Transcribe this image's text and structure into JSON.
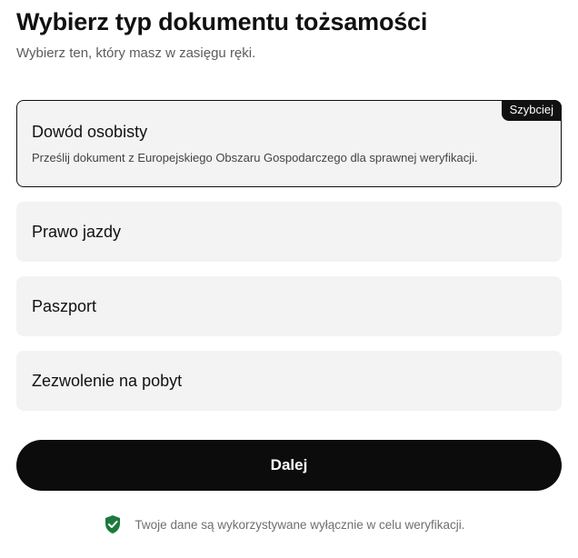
{
  "header": {
    "title": "Wybierz typ dokumentu tożsamości",
    "subtitle": "Wybierz ten, który masz w zasięgu ręki."
  },
  "options": [
    {
      "label": "Dowód osobisty",
      "description": "Prześlij dokument z Europejskiego Obszaru Gospodarczego dla sprawnej weryfikacji.",
      "badge": "Szybciej",
      "selected": true
    },
    {
      "label": "Prawo jazdy",
      "selected": false
    },
    {
      "label": "Paszport",
      "selected": false
    },
    {
      "label": "Zezwolenie na pobyt",
      "selected": false
    }
  ],
  "actions": {
    "next_label": "Dalej"
  },
  "footer": {
    "icon": "shield-check-icon",
    "text": "Twoje dane są wykorzystywane wyłącznie w celu weryfikacji."
  },
  "colors": {
    "primary": "#0c0c0c",
    "option_bg": "#f3f3f3",
    "shield_green": "#1e7a3c"
  }
}
